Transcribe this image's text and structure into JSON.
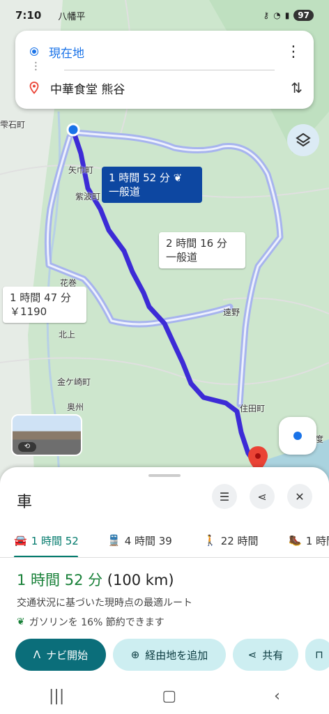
{
  "status_bar": {
    "time": "7:10",
    "location_text": "八幡平",
    "battery": "97"
  },
  "search": {
    "origin": "現在地",
    "destination": "中華食堂 熊谷"
  },
  "map": {
    "towns": [
      "雫石町",
      "矢巾町",
      "紫波町",
      "花巻",
      "北上",
      "遠野",
      "金ケ崎町",
      "奥州",
      "住田町",
      "度"
    ],
    "routes": {
      "selected": {
        "duration": "1 時間 52 分",
        "type": "一般道"
      },
      "alt_east": {
        "duration": "2 時間 16 分",
        "type": "一般道"
      },
      "alt_west": {
        "duration": "1 時間 47 分",
        "toll": "￥1190"
      }
    },
    "colors": {
      "selected_route": "#3d2bd6",
      "alt_route": "#a9b5ef",
      "pin": "#ea4335"
    }
  },
  "sheet": {
    "mode_title": "車",
    "tabs": [
      {
        "icon": "car-icon",
        "label": "1 時間 52"
      },
      {
        "icon": "train-icon",
        "label": "4 時間 39"
      },
      {
        "icon": "walk-icon",
        "label": "22 時間"
      },
      {
        "icon": "hike-icon",
        "label": "1 時間"
      }
    ],
    "summary_duration": "1 時間 52 分",
    "summary_distance": "(100 km)",
    "description": "交通状況に基づいた現時点の最適ルート",
    "eco_text": "ガソリンを 16% 節約できます",
    "actions": {
      "navigate": "ナビ開始",
      "add_stop": "経由地を追加",
      "share": "共有"
    }
  }
}
